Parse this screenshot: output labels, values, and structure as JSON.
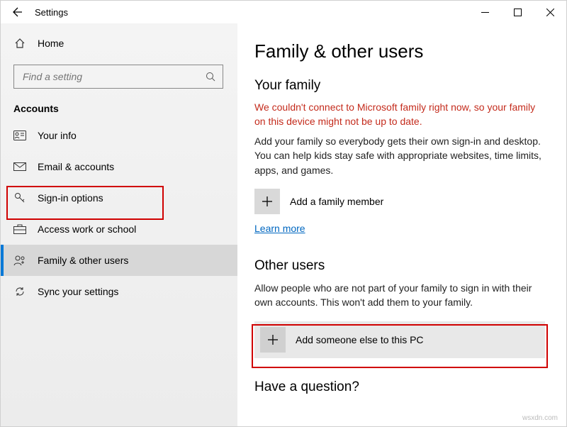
{
  "titlebar": {
    "title": "Settings"
  },
  "sidebar": {
    "home": "Home",
    "search_placeholder": "Find a setting",
    "section": "Accounts",
    "items": [
      {
        "label": "Your info"
      },
      {
        "label": "Email & accounts"
      },
      {
        "label": "Sign-in options"
      },
      {
        "label": "Access work or school"
      },
      {
        "label": "Family & other users"
      },
      {
        "label": "Sync your settings"
      }
    ]
  },
  "main": {
    "heading": "Family & other users",
    "family": {
      "title": "Your family",
      "error": "We couldn't connect to Microsoft family right now, so your family on this device might not be up to date.",
      "desc": "Add your family so everybody gets their own sign-in and desktop. You can help kids stay safe with appropriate websites, time limits, apps, and games.",
      "add_label": "Add a family member",
      "learn_more": "Learn more"
    },
    "other": {
      "title": "Other users",
      "desc": "Allow people who are not part of your family to sign in with their own accounts. This won't add them to your family.",
      "add_label": "Add someone else to this PC"
    },
    "question": "Have a question?"
  },
  "watermark": "wsxdn.com"
}
